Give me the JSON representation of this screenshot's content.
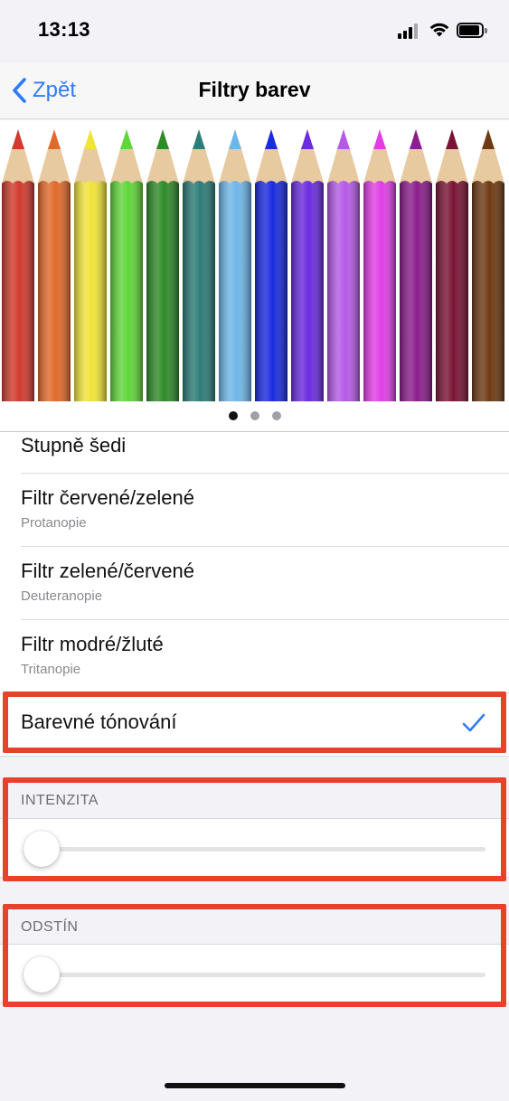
{
  "status_bar": {
    "time": "13:13"
  },
  "nav": {
    "back_label": "Zpět",
    "title": "Filtry barev"
  },
  "pencils": {
    "colors": [
      "#d13a2e",
      "#e06a2c",
      "#f0e33a",
      "#5fd63a",
      "#2f8a2a",
      "#2c7c78",
      "#6fb6e8",
      "#1a2be0",
      "#6a2ce0",
      "#b45ae6",
      "#e03ee6",
      "#8a1e8a",
      "#7a1436",
      "#6e3a14"
    ]
  },
  "pager": {
    "pages": 3,
    "active": 0
  },
  "filters": {
    "grayscale": {
      "title": "Stupně šedi"
    },
    "protan": {
      "title": "Filtr červené/zelené",
      "subtitle": "Protanopie"
    },
    "deutan": {
      "title": "Filtr zelené/červené",
      "subtitle": "Deuteranopie"
    },
    "tritan": {
      "title": "Filtr modré/žluté",
      "subtitle": "Tritanopie"
    },
    "tint": {
      "title": "Barevné tónování",
      "selected": true
    }
  },
  "intensity": {
    "header": "INTENZITA",
    "value": 0
  },
  "hue": {
    "header": "ODSTÍN",
    "value": 0
  },
  "colors": {
    "accent": "#2f7cf6",
    "highlight": "#e9412c"
  }
}
